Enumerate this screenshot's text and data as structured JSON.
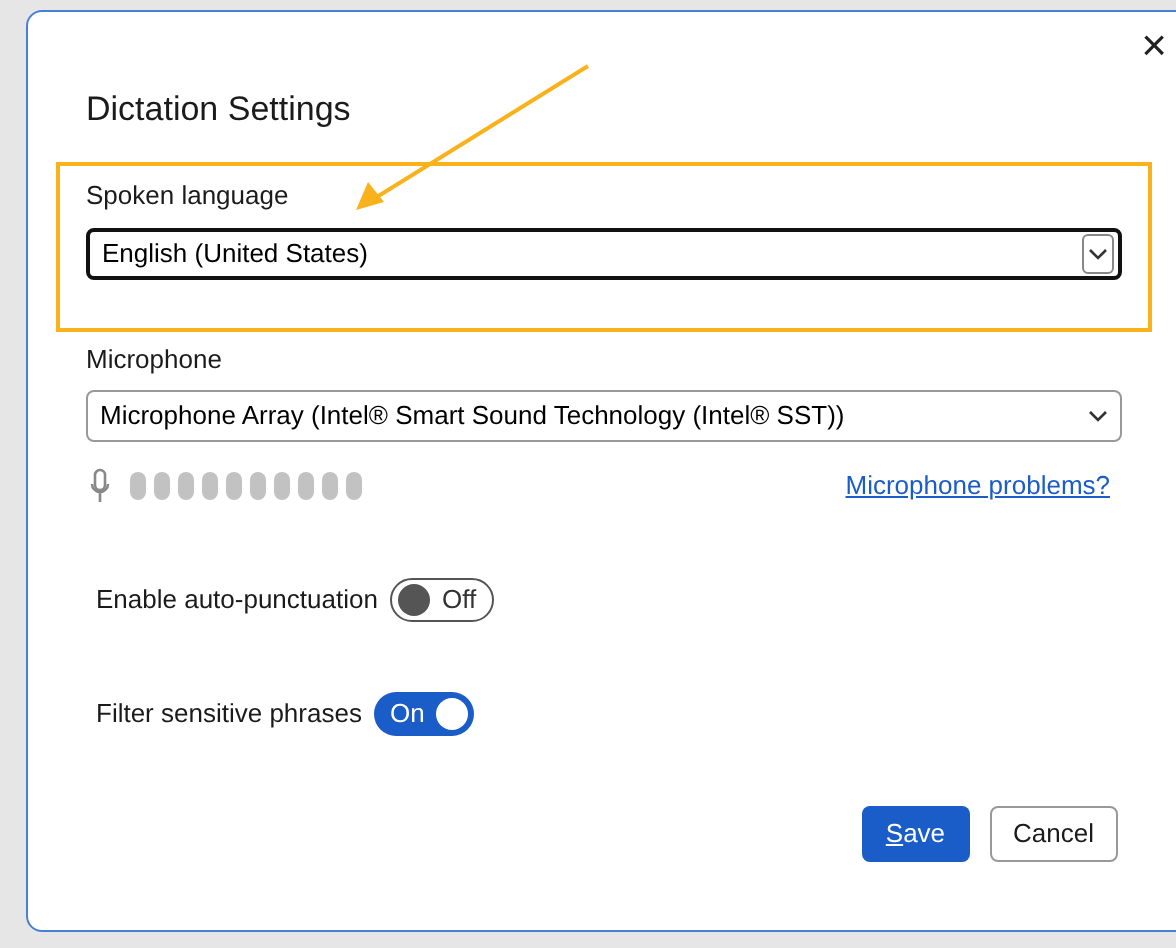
{
  "dialog": {
    "title": "Dictation Settings",
    "close": "×"
  },
  "spoken_language": {
    "label": "Spoken language",
    "value": "English (United States)",
    "focused": true
  },
  "microphone": {
    "label": "Microphone",
    "value": "Microphone Array (Intel® Smart Sound Technology (Intel® SST))",
    "link": "Microphone problems?"
  },
  "toggles": [
    {
      "label": "Enable auto-punctuation",
      "on": false,
      "state_text": "Off"
    },
    {
      "label": "Filter sensitive phrases",
      "on": true,
      "state_text": "On"
    }
  ],
  "buttons": [
    {
      "label": "Save",
      "kind": "primary"
    },
    {
      "label": "Cancel",
      "kind": "secondary"
    }
  ]
}
